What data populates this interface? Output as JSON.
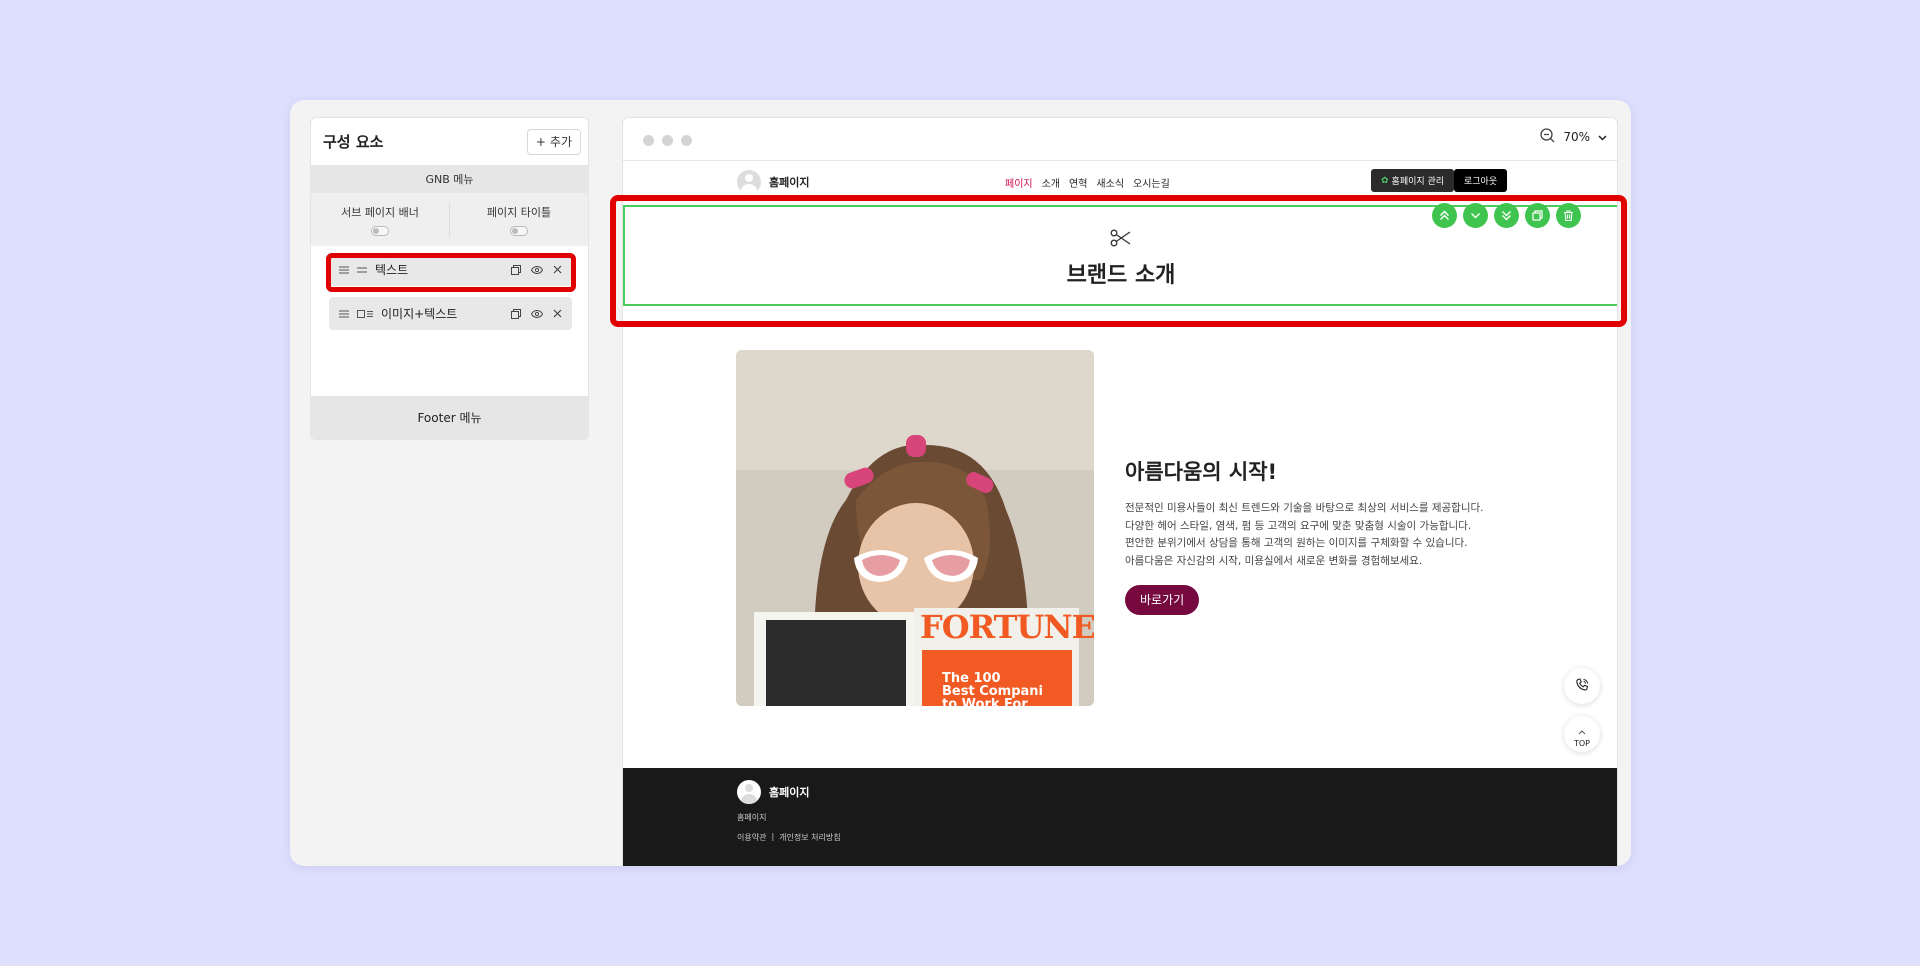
{
  "panel": {
    "title": "구성 요소",
    "add_label": "추가",
    "gnb_label": "GNB 메뉴",
    "sub_banner_label": "서브 페이지 배너",
    "page_title_label": "페이지 타이틀",
    "items": [
      {
        "label": "텍스트"
      },
      {
        "label": "이미지+텍스트"
      }
    ],
    "footer_label": "Footer 메뉴"
  },
  "preview": {
    "zoom": "70%",
    "site_name": "홈페이지",
    "nav": [
      "페이지",
      "소개",
      "연혁",
      "새소식",
      "오시는길"
    ],
    "manage_label": "홈페이지 관리",
    "logout_label": "로그아웃",
    "banner_title": "브랜드 소개",
    "content": {
      "title": "아름다움의 시작!",
      "desc": [
        "전문적인 미용사들이 최신 트렌드와 기술을 바탕으로 최상의 서비스를 제공합니다.",
        "다양한 헤어 스타일, 염색, 펌 등 고객의 요구에 맞춘 맞춤형 시술이 가능합니다.",
        "편안한 분위기에서 상담을 통해 고객의 원하는 이미지를 구체화할 수 있습니다.",
        "아름다움은 자신감의 시작, 미용실에서 새로운 변화를 경험해보세요."
      ],
      "button_label": "바로가기",
      "magazine_title": "FORTUNE",
      "magazine_cover_lines": [
        "The 100",
        "Best Compani",
        "to Work For"
      ]
    },
    "top_label": "TOP",
    "footer": {
      "site_name": "홈페이지",
      "company": "홈페이지",
      "links": [
        "이용약관",
        "개인정보 처리방침"
      ]
    }
  },
  "colors": {
    "background": "#dedffd",
    "highlight": "#e00000",
    "accent_green": "#3fc44f",
    "nav_active": "#d0104c",
    "cta": "#760a3f"
  }
}
